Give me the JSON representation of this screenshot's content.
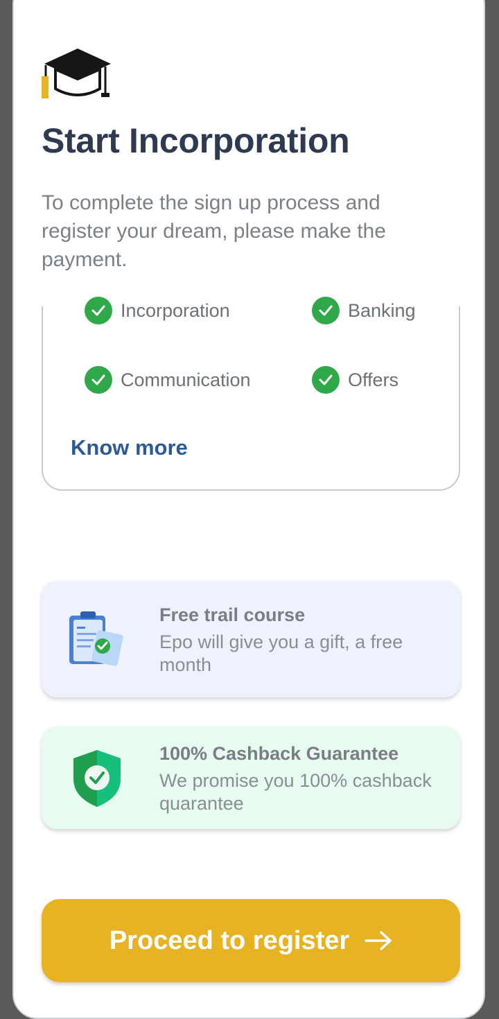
{
  "header": {
    "icon": "graduation-cap-icon",
    "title": "Start Incorporation",
    "subtitle": "To complete the sign up process and register your dream, please make the payment."
  },
  "features": {
    "items": [
      {
        "label": "Incorporation",
        "icon": "check-circle-icon"
      },
      {
        "label": "Banking",
        "icon": "check-circle-icon"
      },
      {
        "label": "Communication",
        "icon": "check-circle-icon"
      },
      {
        "label": "Offers",
        "icon": "check-circle-icon"
      }
    ],
    "know_more": "Know more"
  },
  "cards": {
    "trial": {
      "icon": "clipboard-check-icon",
      "title": "Free trail course",
      "desc": "Epo will give you a gift, a free month"
    },
    "cashback": {
      "icon": "shield-check-icon",
      "title": "100% Cashback Guarantee",
      "desc": "We promise you 100% cashback quarantee"
    }
  },
  "cta": {
    "label": "Proceed to register",
    "icon": "arrow-right-icon"
  },
  "colors": {
    "accent": "#e7b323",
    "check": "#2fa84a",
    "link": "#2d5a97",
    "title": "#2e3a50"
  }
}
